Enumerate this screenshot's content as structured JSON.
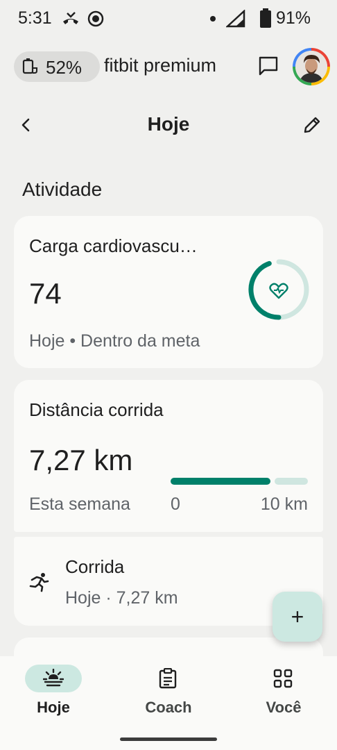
{
  "status_bar": {
    "time": "5:31",
    "battery": "91%",
    "icons": [
      "missed-call-icon",
      "data-saver-icon",
      "dot-icon",
      "signal-icon",
      "battery-icon"
    ]
  },
  "header": {
    "device_battery": "52%",
    "brand": "fitbit premium",
    "icons": [
      "device-battery-icon",
      "chat-icon",
      "avatar"
    ]
  },
  "nav": {
    "title": "Hoje",
    "icons": [
      "back-icon",
      "edit-icon"
    ]
  },
  "section_title": "Atividade",
  "cards": {
    "cardio": {
      "title": "Carga cardiovascu…",
      "value": "74",
      "subtitle": "Hoje • Dentro da meta",
      "gauge_fraction": 0.74,
      "icon": "heart-icon"
    },
    "distance": {
      "title": "Distância corrida",
      "value": "7,27 km",
      "period": "Esta semana",
      "range_min": "0",
      "range_max": "10 km",
      "progress_fraction": 0.727
    },
    "run": {
      "title": "Corrida",
      "subtitle": "Hoje · 7,27 km",
      "icon": "running-icon"
    }
  },
  "fab": {
    "label": "+"
  },
  "bottom_nav": {
    "items": [
      {
        "label": "Hoje",
        "icon": "sunrise-icon",
        "active": true
      },
      {
        "label": "Coach",
        "icon": "clipboard-icon",
        "active": false
      },
      {
        "label": "Você",
        "icon": "grid-icon",
        "active": false
      }
    ]
  },
  "colors": {
    "accent": "#00806a",
    "accent_light": "#cfe6e0",
    "background": "#f0f0ee",
    "card": "#fafaf8"
  }
}
